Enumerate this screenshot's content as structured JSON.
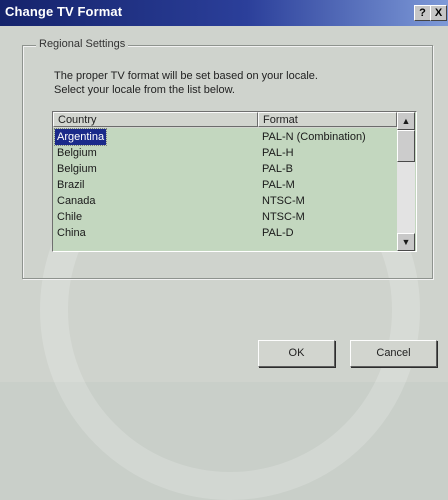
{
  "window": {
    "title": "Change TV Format"
  },
  "title_buttons": {
    "help": "?",
    "close": "X"
  },
  "group": {
    "legend": "Regional Settings",
    "description_line1": "The proper TV format will be set based on your locale.",
    "description_line2": "Select your locale from the list below."
  },
  "list": {
    "columns": {
      "country": "Country",
      "format": "Format"
    },
    "rows": [
      {
        "country": "Argentina",
        "format": "PAL-N (Combination)",
        "selected": true
      },
      {
        "country": "Belgium",
        "format": "PAL-H"
      },
      {
        "country": "Belgium",
        "format": "PAL-B"
      },
      {
        "country": "Brazil",
        "format": "PAL-M"
      },
      {
        "country": "Canada",
        "format": "NTSC-M"
      },
      {
        "country": "Chile",
        "format": "NTSC-M"
      },
      {
        "country": "China",
        "format": "PAL-D"
      }
    ]
  },
  "scrollbar": {
    "up": "▲",
    "down": "▼"
  },
  "buttons": {
    "ok": "OK",
    "cancel": "Cancel"
  },
  "colors": {
    "title_start": "#15236b",
    "title_end": "#7e9ad8",
    "list_bg": "#c3d7bf",
    "selection": "#1a2a8a"
  }
}
